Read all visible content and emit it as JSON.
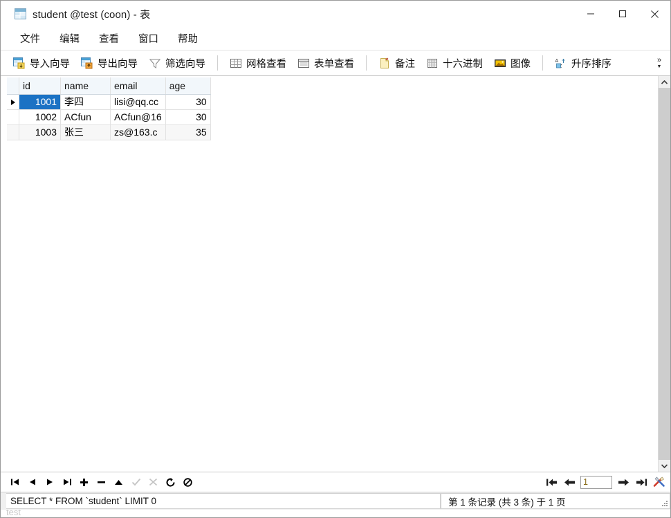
{
  "window": {
    "title": "student @test (coon) - 表",
    "icon": "table-window-icon",
    "controls": {
      "minimize": "minimize-button",
      "maximize": "maximize-button",
      "close": "close-button"
    }
  },
  "menubar": {
    "items": [
      {
        "label": "文件",
        "name": "menu-file"
      },
      {
        "label": "编辑",
        "name": "menu-edit"
      },
      {
        "label": "查看",
        "name": "menu-view"
      },
      {
        "label": "窗口",
        "name": "menu-window"
      },
      {
        "label": "帮助",
        "name": "menu-help"
      }
    ]
  },
  "toolbar": {
    "groups": [
      [
        {
          "label": "导入向导",
          "icon": "import-wizard-icon"
        },
        {
          "label": "导出向导",
          "icon": "export-wizard-icon"
        },
        {
          "label": "筛选向导",
          "icon": "filter-wizard-icon"
        }
      ],
      [
        {
          "label": "网格查看",
          "icon": "grid-view-icon"
        },
        {
          "label": "表单查看",
          "icon": "form-view-icon"
        }
      ],
      [
        {
          "label": "备注",
          "icon": "memo-icon"
        },
        {
          "label": "十六进制",
          "icon": "hex-icon"
        },
        {
          "label": "图像",
          "icon": "image-icon"
        }
      ],
      [
        {
          "label": "升序排序",
          "icon": "sort-ascending-icon"
        }
      ]
    ],
    "overflow_label": "»"
  },
  "grid": {
    "columns": [
      "id",
      "name",
      "email",
      "age"
    ],
    "rows": [
      {
        "id": "1001",
        "name": "李四",
        "email": "lisi@qq.cc",
        "age": "30",
        "current": true
      },
      {
        "id": "1002",
        "name": "ACfun",
        "email": "ACfun@16",
        "age": "30",
        "current": false
      },
      {
        "id": "1003",
        "name": "张三",
        "email": "zs@163.c",
        "age": "35",
        "current": false
      }
    ],
    "selected_cell": {
      "row": 0,
      "column": "id"
    }
  },
  "navbar": {
    "buttons": [
      {
        "name": "first-record-button",
        "glyph": "⏮",
        "disabled": false
      },
      {
        "name": "previous-record-button",
        "glyph": "◀",
        "disabled": false
      },
      {
        "name": "next-record-button",
        "glyph": "▶",
        "disabled": false
      },
      {
        "name": "last-record-button",
        "glyph": "⏭",
        "disabled": false
      },
      {
        "name": "add-record-button",
        "glyph": "✚",
        "disabled": false
      },
      {
        "name": "delete-record-button",
        "glyph": "−",
        "disabled": false
      },
      {
        "name": "apply-change-button",
        "glyph": "▲",
        "disabled": false
      },
      {
        "name": "confirm-edit-button",
        "glyph": "✓",
        "disabled": true
      },
      {
        "name": "cancel-edit-button",
        "glyph": "✗",
        "disabled": true
      },
      {
        "name": "refresh-button",
        "glyph": "⟳",
        "disabled": false
      },
      {
        "name": "stop-button",
        "glyph": "⊘",
        "disabled": false
      }
    ],
    "pager": {
      "first_page": "⇤",
      "previous_page": "⬅",
      "page_value": "1",
      "next_page": "➡",
      "last_page": "⇥",
      "tools_icon": "tools-icon"
    }
  },
  "statusbar": {
    "sql": "SELECT * FROM `student` LIMIT 0",
    "record_info": "第 1 条记录 (共 3 条) 于 1 页",
    "ghost_text": "test"
  },
  "colors": {
    "selection": "#1b72c4",
    "header_bg": "#f2f7fb",
    "alt_row": "#f7f7f7",
    "scroll_thumb": "#cdcdcd"
  }
}
